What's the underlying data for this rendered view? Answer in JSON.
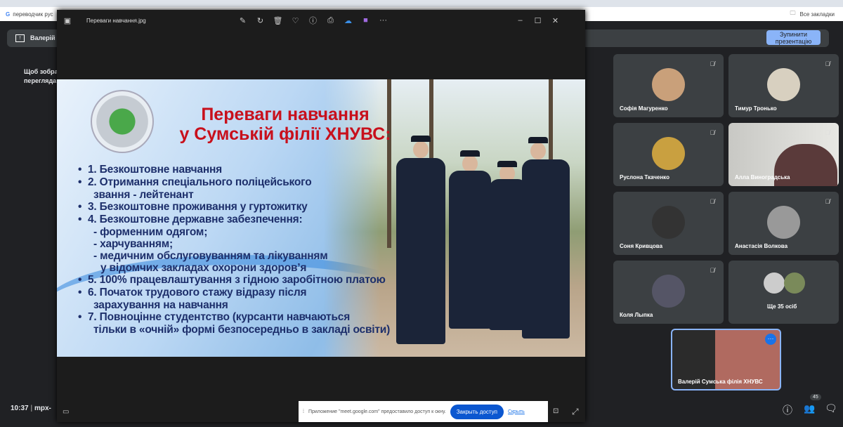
{
  "browser": {
    "bookmark_left": "переводчик рус",
    "all_bookmarks": "Все закладки"
  },
  "meet": {
    "presenter_chip": "Валерій",
    "stop_button": "Зупинити презентацію",
    "hint_line1": "Щоб зобра",
    "hint_line2": "перегляда",
    "time": "10:37",
    "meeting_code": "mpx-",
    "participants_count": "45"
  },
  "viewer": {
    "file_name": "Переваги навчання.jpg",
    "more": "···"
  },
  "slide": {
    "title_line1": "Переваги навчання",
    "title_line2": "у Сумській філії ХНУВС:",
    "items": [
      "1. Безкоштовне навчання",
      "2. Отримання спеціального поліцейського",
      "звання - лейтенант",
      "3. Безкоштовне проживання у гуртожитку",
      "4. Безкоштовне державне забезпечення:",
      "- форменним одягом;",
      "- харчуванням;",
      "- медичним обслуговуванням та лікуванням",
      "у відомчих закладах охорони здоров’я",
      "5. 100% працевлаштування з гідною заробітною платою",
      "6. Початок трудового стажу відразу після",
      "зарахування на навчання",
      "7. Повноцінне студентство  (курсанти навчаються",
      "тільки в «очній» формі безпосередньо в закладі освіти)"
    ]
  },
  "participants": [
    {
      "name": "Софія Магуренко",
      "color": "#c9a07a"
    },
    {
      "name": "Тимур Тронько",
      "color": "#d8d0c0"
    },
    {
      "name": "Руслона Ткаченко",
      "color": "#c9a040"
    },
    {
      "name": "Алла Виноградська",
      "color": "#ddd"
    },
    {
      "name": "Соня Кривцова",
      "color": "#333"
    },
    {
      "name": "Анастасія Волкова",
      "color": "#999"
    },
    {
      "name": "Коля Лыпка",
      "color": "#556"
    },
    {
      "name": "Ще 35 осіб",
      "color": "#aaa"
    }
  ],
  "self_view": {
    "name": "Валерій Сумська філія ХНУВС"
  },
  "notification": {
    "text": "Приложение \"meet.google.com\" предоставило доступ к окну.",
    "close_access": "Закрыть доступ",
    "hide": "Скрыть"
  }
}
